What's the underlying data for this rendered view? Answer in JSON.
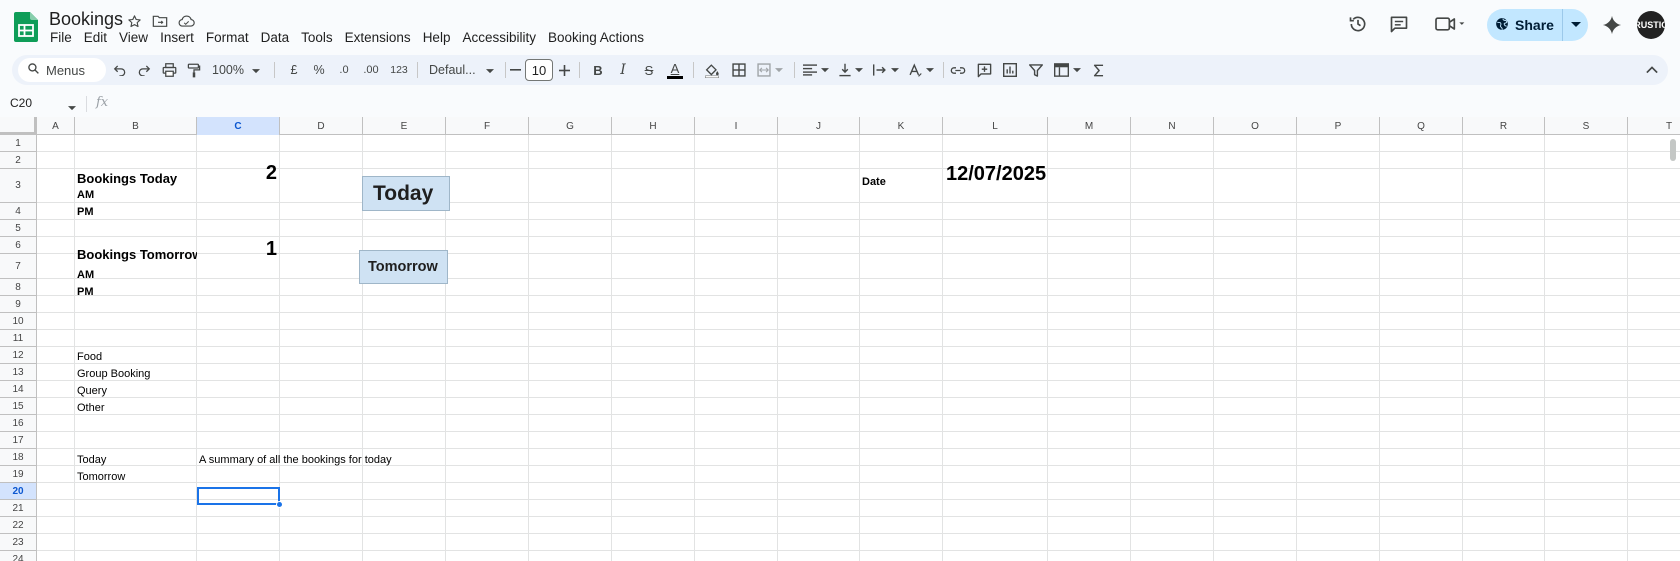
{
  "app": {
    "title": "Bookings",
    "menus": [
      "File",
      "Edit",
      "View",
      "Insert",
      "Format",
      "Data",
      "Tools",
      "Extensions",
      "Help",
      "Accessibility",
      "Booking Actions"
    ]
  },
  "header": {
    "share_label": "Share",
    "avatar_label": "RUSTIC"
  },
  "toolbar": {
    "search_label": "Menus",
    "zoom": "100%",
    "currency": "£",
    "percent": "%",
    "dec_decrease": ".0",
    "dec_increase": ".00",
    "number_format": "123",
    "font": "Defaul...",
    "font_size": "10",
    "bold": "B",
    "italic": "I",
    "strike": "S",
    "text_color": "A"
  },
  "formula_bar": {
    "name_box": "C20",
    "fx": "fx",
    "content": ""
  },
  "grid": {
    "columns": [
      "A",
      "B",
      "C",
      "D",
      "E",
      "F",
      "G",
      "H",
      "I",
      "J",
      "K",
      "L",
      "M",
      "N",
      "O",
      "P",
      "Q",
      "R",
      "S",
      "T"
    ],
    "rows": [
      "1",
      "2",
      "3",
      "4",
      "5",
      "6",
      "7",
      "8",
      "9",
      "10",
      "11",
      "12",
      "13",
      "14",
      "15",
      "16",
      "17",
      "18",
      "19",
      "20",
      "21",
      "22",
      "23",
      "24"
    ],
    "active_cell": "C20",
    "active_column": "C",
    "active_row": "20",
    "cells": {
      "b3": "Bookings Today",
      "c3": "2",
      "b4": "AM",
      "b5": "PM",
      "b7": "Bookings Tomorrow",
      "c7": "1",
      "b8": "AM",
      "b9": "PM",
      "b13": "Food",
      "b14": "Group Booking",
      "b15": "Query",
      "b16": "Other",
      "b19": "Today",
      "c19": "A summary of all the bookings for today",
      "b20": "Tomorrow",
      "k3": "Date",
      "l3": "12/07/2025"
    },
    "buttons": {
      "today": "Today",
      "tomorrow": "Tomorrow"
    }
  },
  "colors": {
    "accent": "#1a73e8",
    "share_bg": "#c2e7ff",
    "button_bg": "#cfe2f3",
    "sheets_green": "#0f9d58"
  }
}
